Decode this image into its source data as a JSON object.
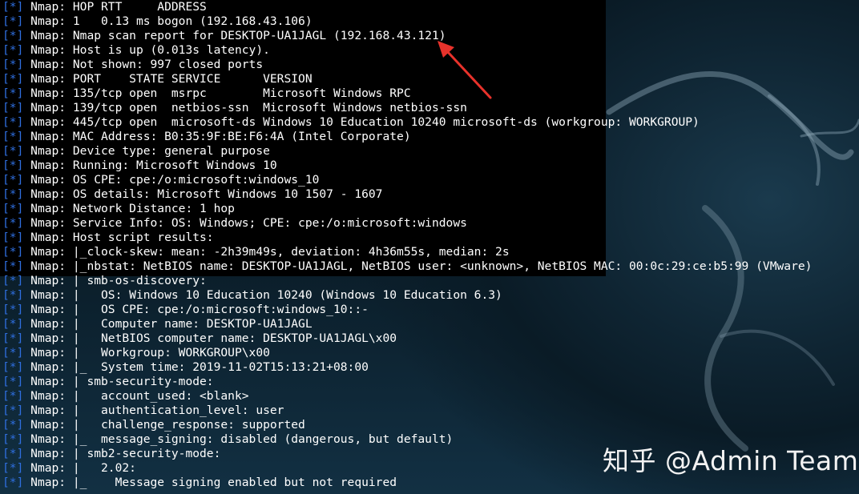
{
  "terminal": {
    "prefix": "[*]",
    "lines": [
      "Nmap: HOP RTT     ADDRESS",
      "Nmap: 1   0.13 ms bogon (192.168.43.106)",
      "Nmap: Nmap scan report for DESKTOP-UA1JAGL (192.168.43.121)",
      "Nmap: Host is up (0.013s latency).",
      "Nmap: Not shown: 997 closed ports",
      "Nmap: PORT    STATE SERVICE      VERSION",
      "Nmap: 135/tcp open  msrpc        Microsoft Windows RPC",
      "Nmap: 139/tcp open  netbios-ssn  Microsoft Windows netbios-ssn",
      "Nmap: 445/tcp open  microsoft-ds Windows 10 Education 10240 microsoft-ds (workgroup: WORKGROUP)",
      "Nmap: MAC Address: B0:35:9F:BE:F6:4A (Intel Corporate)",
      "Nmap: Device type: general purpose",
      "Nmap: Running: Microsoft Windows 10",
      "Nmap: OS CPE: cpe:/o:microsoft:windows_10",
      "Nmap: OS details: Microsoft Windows 10 1507 - 1607",
      "Nmap: Network Distance: 1 hop",
      "Nmap: Service Info: OS: Windows; CPE: cpe:/o:microsoft:windows",
      "Nmap: Host script results:",
      "Nmap: |_clock-skew: mean: -2h39m49s, deviation: 4h36m55s, median: 2s",
      "Nmap: |_nbstat: NetBIOS name: DESKTOP-UA1JAGL, NetBIOS user: <unknown>, NetBIOS MAC: 00:0c:29:ce:b5:99 (VMware)",
      "Nmap: | smb-os-discovery:",
      "Nmap: |   OS: Windows 10 Education 10240 (Windows 10 Education 6.3)",
      "Nmap: |   OS CPE: cpe:/o:microsoft:windows_10::-",
      "Nmap: |   Computer name: DESKTOP-UA1JAGL",
      "Nmap: |   NetBIOS computer name: DESKTOP-UA1JAGL\\x00",
      "Nmap: |   Workgroup: WORKGROUP\\x00",
      "Nmap: |_  System time: 2019-11-02T15:13:21+08:00",
      "Nmap: | smb-security-mode:",
      "Nmap: |   account_used: <blank>",
      "Nmap: |   authentication_level: user",
      "Nmap: |   challenge_response: supported",
      "Nmap: |_  message_signing: disabled (dangerous, but default)",
      "Nmap: | smb2-security-mode:",
      "Nmap: |   2.02:",
      "Nmap: |_    Message signing enabled but not required"
    ]
  },
  "watermark": "知乎 @Admin Team",
  "colors": {
    "prefix": "#2f6fe0",
    "text": "#ffffff",
    "arrow": "#e8322b",
    "wallpaper": "#0b1e2a"
  },
  "icons": {
    "annotation": "red-arrow-pointer",
    "background": "kali-dragon-wallpaper"
  }
}
